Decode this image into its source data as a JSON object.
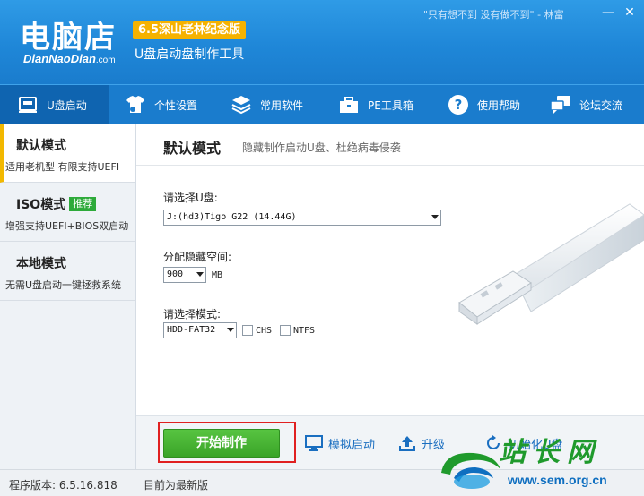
{
  "window": {
    "logo_text": "电脑店",
    "logo_sub_main": "DianNaoDian",
    "logo_sub_domain": ".com",
    "version_badge": "6.5深山老林纪念版",
    "app_subtitle": "U盘启动盘制作工具",
    "motto": "\"只有想不到 没有做不到\" - 林富",
    "minimize_symbol": "—",
    "close_symbol": "✕"
  },
  "nav": [
    {
      "label": "U盘启动",
      "icon": "usb-drive-icon",
      "active": true
    },
    {
      "label": "个性设置",
      "icon": "tshirt-gear-icon",
      "active": false
    },
    {
      "label": "常用软件",
      "icon": "layers-icon",
      "active": false
    },
    {
      "label": "PE工具箱",
      "icon": "toolbox-icon",
      "active": false
    },
    {
      "label": "使用帮助",
      "icon": "help-circle-icon",
      "active": false
    },
    {
      "label": "论坛交流",
      "icon": "chat-bubbles-icon",
      "active": false
    }
  ],
  "sidebar": {
    "items": [
      {
        "title": "默认模式",
        "desc": "适用老机型 有限支持UEFI",
        "active": true
      },
      {
        "title": "ISO模式",
        "tag": "推荐",
        "desc": "增强支持UEFI+BIOS双启动",
        "active": false
      },
      {
        "title": "本地模式",
        "desc": "无需U盘启动一键拯救系统",
        "active": false
      }
    ]
  },
  "main": {
    "title": "默认模式",
    "description": "隐藏制作启动U盘、杜绝病毒侵袭",
    "disk_label": "请选择U盘:",
    "disk_value": "J:(hd3)Tigo G22 (14.44G)",
    "hidden_space_label": "分配隐藏空间:",
    "hidden_space_value": "900",
    "hidden_space_unit": "MB",
    "mode_label": "请选择模式:",
    "mode_value": "HDD-FAT32",
    "chs_label": "CHS",
    "chs_checked": false,
    "ntfs_label": "NTFS",
    "ntfs_checked": false
  },
  "actions": {
    "start_label": "开始制作",
    "simulate_label": "模拟启动",
    "upgrade_label": "升级",
    "init_label": "初始化U盘"
  },
  "status": {
    "version_text": "程序版本: 6.5.16.818",
    "update_text": "目前为最新版"
  },
  "watermark": {
    "title": "站长网",
    "url": "www.sem.org.cn"
  },
  "colors": {
    "brand_blue": "#1f87d8",
    "nav_active": "#0f64b0",
    "badge_yellow": "#f6b200",
    "start_green": "#3aa428",
    "highlight_red": "#e02020",
    "link_blue": "#1a6ec0"
  }
}
